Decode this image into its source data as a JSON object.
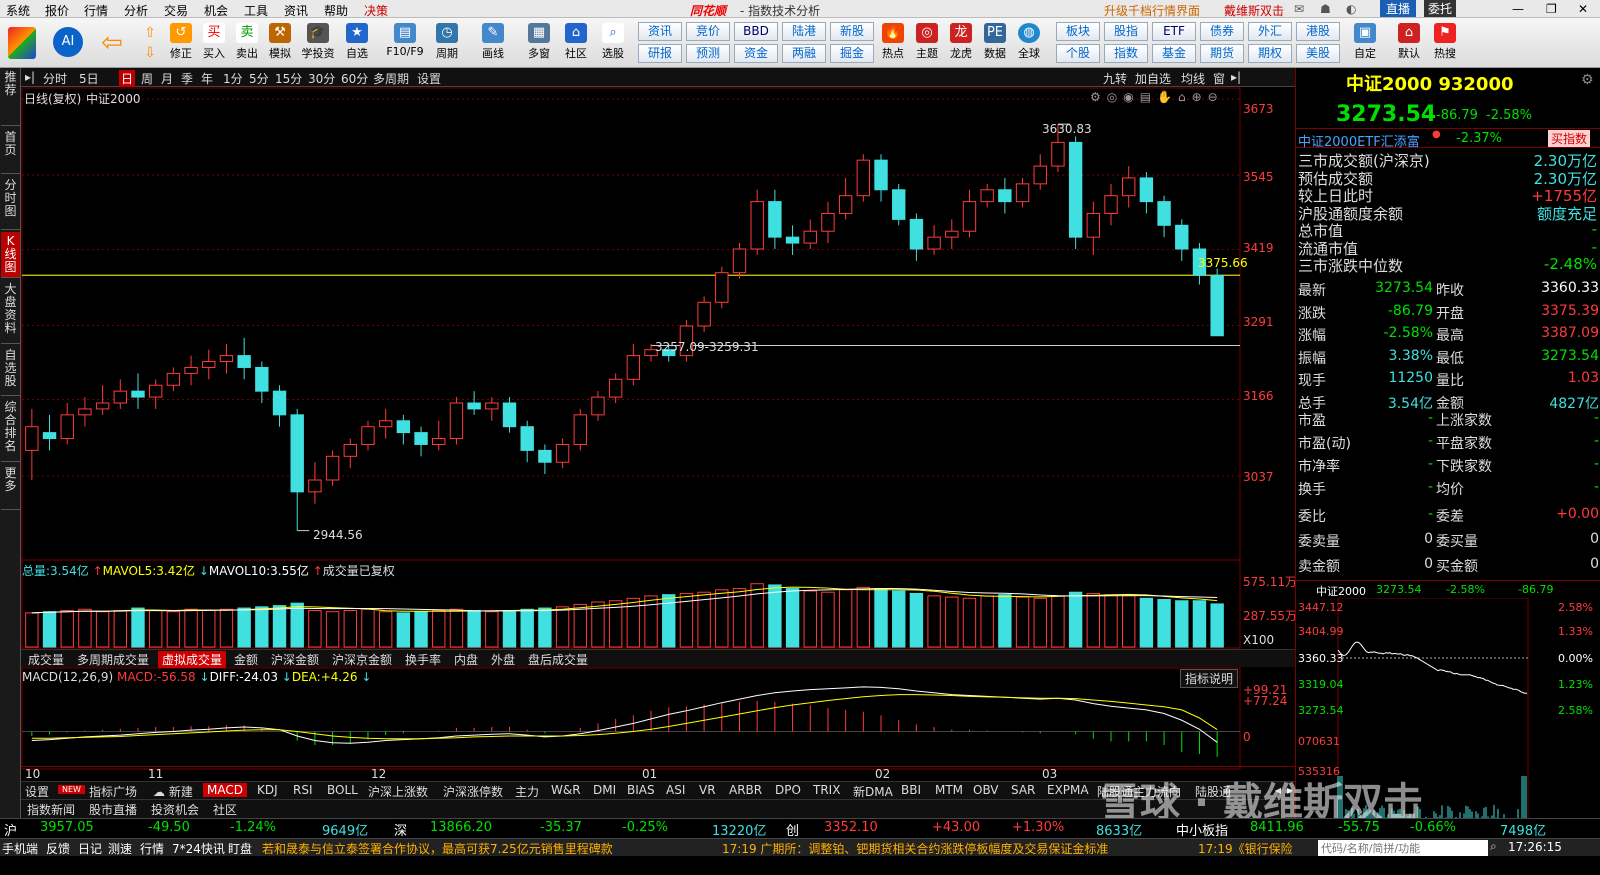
{
  "menu": [
    "系统",
    "报价",
    "行情",
    "分析",
    "交易",
    "机会",
    "工具",
    "资讯",
    "帮助",
    "决策"
  ],
  "app_logo": "同花顺",
  "window_title": "- 指数技术分析",
  "upgrade_link": "升级千档行情界面",
  "brand_link": "戴维斯双击",
  "live_btn": "直播",
  "user_btn": "委托",
  "toolbar": {
    "buttons": [
      "修正",
      "买入",
      "卖出",
      "模拟",
      "学投资",
      "自选",
      "F10/F9",
      "周期",
      "画线",
      "多窗",
      "社区",
      "选股",
      "热点",
      "主题",
      "龙虎",
      "数据",
      "全球",
      "自定",
      "默认",
      "热搜"
    ],
    "small_top": [
      "资讯",
      "竞价",
      "BBD",
      "陆港",
      "新股",
      "板块",
      "股指",
      "ETF",
      "债券",
      "外汇",
      "港股"
    ],
    "small_bot": [
      "研报",
      "预测",
      "资金",
      "两融",
      "掘金",
      "个股",
      "指数",
      "基金",
      "期货",
      "期权",
      "美股"
    ]
  },
  "left_nav": [
    "推荐",
    "首页",
    "分时图",
    "K线图",
    "大盘资料",
    "自选股",
    "综合排名",
    "更多"
  ],
  "periods": [
    "分时",
    "5日",
    "日",
    "周",
    "月",
    "季",
    "年",
    "1分",
    "5分",
    "15分",
    "30分",
    "60分",
    "多周期",
    "设置"
  ],
  "period_active": "日",
  "chart_right_tabs": [
    "九转",
    "加自选",
    "均线",
    "窗"
  ],
  "chart_header": {
    "mode": "日线(复权)",
    "name": "中证2000"
  },
  "price_annotations": {
    "high": "3630.83",
    "low": "2944.56",
    "gap": "3257.09-3259.31",
    "ref_line": "3375.66"
  },
  "volume_header": {
    "label": "总量:",
    "vol": "3.54亿",
    "mavol5_label": "MAVOL5:",
    "mavol5": "3.42亿",
    "mavol10_label": "MAVOL10:",
    "mavol10": "3.55亿",
    "note": "成交量已复权"
  },
  "volume_axis": [
    "575.11万",
    "287.55万",
    "X100"
  ],
  "vol_tabs": [
    "成交量",
    "多周期成交量",
    "虚拟成交量",
    "金额",
    "沪深金额",
    "沪深京金额",
    "换手率",
    "内盘",
    "外盘",
    "盘后成交量"
  ],
  "vol_tab_active": "虚拟成交量",
  "macd_header": {
    "label": "MACD(12,26,9)",
    "macd_label": "MACD:",
    "macd": "-56.58",
    "diff_label": "DIFF:",
    "diff": "-24.03",
    "dea_label": "DEA:",
    "dea": "+4.26"
  },
  "macd_button": "指标说明",
  "macd_axis": [
    "+99.21",
    "+77.24",
    "0"
  ],
  "date_axis": [
    "10",
    "11",
    "12",
    "01",
    "02",
    "03"
  ],
  "indicator_tabs": [
    "设置",
    "指标广场",
    "新建",
    "MACD",
    "KDJ",
    "RSI",
    "BOLL",
    "沪深上涨数",
    "沪深涨停数",
    "主力",
    "W&R",
    "DMI",
    "BIAS",
    "ASI",
    "VR",
    "ARBR",
    "DPO",
    "TRIX",
    "新DMA",
    "BBI",
    "MTM",
    "OBV",
    "SAR",
    "EXPMA",
    "陆股通主力流向",
    "陆股通"
  ],
  "indicator_active": "MACD",
  "new_badge": "NEW",
  "bottom_tabs": [
    "指数新闻",
    "股市直播",
    "投资机会",
    "社区"
  ],
  "chart_data": [
    {
      "type": "candlestick",
      "title": "中证2000",
      "ylim": [
        2900,
        3680
      ],
      "y_ticks": [
        3673,
        3545,
        3419,
        3291,
        3166,
        3037
      ],
      "x_ticks": [
        "10",
        "11",
        "12",
        "01",
        "02",
        "03"
      ],
      "candles": [
        [
          3080,
          3120,
          3150,
          3030
        ],
        [
          3110,
          3100,
          3140,
          3080
        ],
        [
          3100,
          3140,
          3160,
          3090
        ],
        [
          3140,
          3150,
          3170,
          3120
        ],
        [
          3150,
          3160,
          3190,
          3140
        ],
        [
          3160,
          3180,
          3200,
          3150
        ],
        [
          3180,
          3170,
          3210,
          3150
        ],
        [
          3170,
          3190,
          3200,
          3150
        ],
        [
          3190,
          3210,
          3220,
          3180
        ],
        [
          3210,
          3220,
          3240,
          3190
        ],
        [
          3220,
          3230,
          3250,
          3200
        ],
        [
          3230,
          3240,
          3260,
          3210
        ],
        [
          3240,
          3220,
          3270,
          3200
        ],
        [
          3220,
          3180,
          3230,
          3160
        ],
        [
          3180,
          3140,
          3190,
          3120
        ],
        [
          3140,
          3010,
          3150,
          2944.56
        ],
        [
          3010,
          3030,
          3060,
          2990
        ],
        [
          3030,
          3070,
          3080,
          3020
        ],
        [
          3070,
          3090,
          3100,
          3050
        ],
        [
          3090,
          3120,
          3130,
          3080
        ],
        [
          3120,
          3130,
          3150,
          3100
        ],
        [
          3130,
          3110,
          3140,
          3090
        ],
        [
          3110,
          3090,
          3120,
          3070
        ],
        [
          3090,
          3100,
          3130,
          3080
        ],
        [
          3100,
          3160,
          3170,
          3090
        ],
        [
          3160,
          3150,
          3180,
          3140
        ],
        [
          3150,
          3160,
          3170,
          3130
        ],
        [
          3160,
          3120,
          3170,
          3110
        ],
        [
          3120,
          3080,
          3130,
          3060
        ],
        [
          3080,
          3060,
          3090,
          3040
        ],
        [
          3060,
          3090,
          3100,
          3050
        ],
        [
          3090,
          3140,
          3150,
          3080
        ],
        [
          3140,
          3170,
          3180,
          3130
        ],
        [
          3170,
          3200,
          3210,
          3160
        ],
        [
          3200,
          3240,
          3260,
          3190
        ],
        [
          3240,
          3250,
          3260,
          3230
        ],
        [
          3250,
          3240,
          3260,
          3230
        ],
        [
          3240,
          3290,
          3300,
          3230
        ],
        [
          3290,
          3330,
          3340,
          3280
        ],
        [
          3330,
          3380,
          3390,
          3320
        ],
        [
          3380,
          3420,
          3430,
          3370
        ],
        [
          3420,
          3500,
          3520,
          3410
        ],
        [
          3500,
          3440,
          3520,
          3420
        ],
        [
          3440,
          3430,
          3460,
          3410
        ],
        [
          3430,
          3450,
          3470,
          3420
        ],
        [
          3450,
          3480,
          3500,
          3430
        ],
        [
          3480,
          3510,
          3540,
          3470
        ],
        [
          3510,
          3570,
          3580,
          3500
        ],
        [
          3570,
          3520,
          3580,
          3500
        ],
        [
          3520,
          3470,
          3530,
          3460
        ],
        [
          3470,
          3420,
          3480,
          3400
        ],
        [
          3420,
          3440,
          3460,
          3410
        ],
        [
          3440,
          3450,
          3470,
          3420
        ],
        [
          3450,
          3500,
          3520,
          3440
        ],
        [
          3500,
          3520,
          3530,
          3490
        ],
        [
          3520,
          3500,
          3540,
          3480
        ],
        [
          3500,
          3530,
          3540,
          3490
        ],
        [
          3530,
          3560,
          3580,
          3520
        ],
        [
          3560,
          3600,
          3630.83,
          3550
        ],
        [
          3600,
          3440,
          3610,
          3420
        ],
        [
          3440,
          3480,
          3500,
          3410
        ],
        [
          3480,
          3510,
          3530,
          3460
        ],
        [
          3510,
          3540,
          3560,
          3490
        ],
        [
          3540,
          3500,
          3550,
          3480
        ],
        [
          3500,
          3460,
          3510,
          3440
        ],
        [
          3460,
          3420,
          3470,
          3400
        ],
        [
          3420,
          3375.66,
          3430,
          3360
        ],
        [
          3375.39,
          3273.54,
          3387.09,
          3273.54
        ]
      ]
    },
    {
      "type": "bar",
      "title": "成交量",
      "ylim": [
        0,
        575.11
      ],
      "values": [
        280,
        290,
        300,
        310,
        290,
        300,
        320,
        300,
        290,
        310,
        300,
        310,
        320,
        330,
        340,
        360,
        300,
        290,
        300,
        310,
        290,
        280,
        290,
        300,
        310,
        300,
        290,
        300,
        310,
        320,
        330,
        350,
        370,
        380,
        400,
        420,
        430,
        440,
        450,
        470,
        480,
        520,
        510,
        480,
        460,
        450,
        470,
        490,
        480,
        460,
        440,
        420,
        410,
        400,
        420,
        430,
        410,
        400,
        420,
        450,
        440,
        430,
        420,
        400,
        390,
        380,
        380,
        354
      ]
    },
    {
      "type": "line",
      "title": "MACD",
      "series": [
        {
          "name": "DIFF",
          "values": [
            -20,
            -18,
            -15,
            -12,
            -10,
            -8,
            -5,
            -2,
            0,
            3,
            5,
            8,
            10,
            8,
            4,
            -10,
            -20,
            -25,
            -26,
            -24,
            -20,
            -18,
            -16,
            -14,
            -10,
            -8,
            -6,
            -5,
            -8,
            -12,
            -10,
            -5,
            2,
            10,
            18,
            28,
            38,
            46,
            55,
            64,
            72,
            80,
            86,
            90,
            93,
            95,
            97,
            99.21,
            98,
            95,
            90,
            86,
            82,
            80,
            78,
            76,
            74,
            72,
            74,
            70,
            62,
            56,
            52,
            48,
            40,
            25,
            5,
            -24.03
          ]
        },
        {
          "name": "DEA",
          "values": [
            -15,
            -15,
            -14,
            -13,
            -12,
            -11,
            -9,
            -7,
            -5,
            -3,
            -1,
            1,
            3,
            4,
            4,
            0,
            -5,
            -10,
            -13,
            -15,
            -16,
            -16,
            -16,
            -15,
            -14,
            -12,
            -11,
            -10,
            -10,
            -10,
            -10,
            -9,
            -7,
            -4,
            0,
            5,
            11,
            18,
            25,
            32,
            39,
            46,
            53,
            59,
            64,
            69,
            73,
            77.24,
            80,
            82,
            82,
            81,
            80,
            78,
            77,
            76,
            75,
            74,
            74,
            73,
            70,
            67,
            63,
            59,
            55,
            48,
            30,
            4.26
          ]
        }
      ]
    }
  ],
  "right_panel": {
    "title": "中证2000 932000",
    "price": "3273.54",
    "change": "-86.79",
    "pct": "-2.58%",
    "etf_name": "中证2000ETF汇添富",
    "etf_pct": "-2.37%",
    "etf_btn": "买指数",
    "rows1": [
      [
        "三市成交额(沪深京)",
        "2.30万亿"
      ],
      [
        "预估成交额",
        "2.30万亿"
      ],
      [
        "较上日此时",
        "+1755亿"
      ],
      [
        "沪股通额度余额",
        "额度充足"
      ],
      [
        "总市值",
        "-"
      ],
      [
        "流通市值",
        "-"
      ],
      [
        "三市涨跌中位数",
        "-2.48%"
      ]
    ],
    "rows2": [
      [
        "最新",
        "3273.54",
        "昨收",
        "3360.33"
      ],
      [
        "涨跌",
        "-86.79",
        "开盘",
        "3375.39"
      ],
      [
        "涨幅",
        "-2.58%",
        "最高",
        "3387.09"
      ],
      [
        "振幅",
        "3.38%",
        "最低",
        "3273.54"
      ],
      [
        "现手",
        "11250",
        "量比",
        "1.03"
      ],
      [
        "总手",
        "3.54亿",
        "金额",
        "4827亿"
      ]
    ],
    "rows3": [
      [
        "市盈",
        "-",
        "上涨家数",
        "-"
      ],
      [
        "市盈(动)",
        "-",
        "平盘家数",
        "-"
      ],
      [
        "市净率",
        "-",
        "下跌家数",
        "-"
      ],
      [
        "换手",
        "-",
        "均价",
        "-"
      ]
    ],
    "rows4": [
      [
        "委比",
        "-",
        "委差",
        "+0.00"
      ],
      [
        "委卖量",
        "0",
        "委买量",
        "0"
      ],
      [
        "卖金额",
        "0",
        "买金额",
        "0"
      ]
    ],
    "mini_header": [
      "中证2000",
      "3273.54",
      "-2.58%",
      "-86.79"
    ],
    "mini_left_axis": [
      "3447.12",
      "3404.99",
      "3360.33",
      "3319.04",
      "3273.54",
      "070631",
      "535316"
    ],
    "mini_right_axis": [
      "2.58%",
      "1.33%",
      "0.00%",
      "1.23%",
      "2.58%"
    ]
  },
  "status": {
    "sh_label": "沪",
    "sh_val": "3957.05",
    "sh_chg": "-49.50",
    "sh_pct": "-1.24%",
    "sh_amt": "9649亿",
    "sz_label": "深",
    "sz_val": "13866.20",
    "sz_chg": "-35.37",
    "sz_pct": "-0.25%",
    "sz_amt": "13220亿",
    "cy_label": "创",
    "cy_val": "3352.10",
    "cy_chg": "+43.00",
    "cy_pct": "+1.30%",
    "cy_amt": "8633亿",
    "zx_label": "中小板指",
    "zx_val": "8411.96",
    "zx_chg": "-55.75",
    "zx_pct": "-0.66%",
    "zx_amt": "7498亿"
  },
  "newsbar": {
    "items": [
      "手机端",
      "反馈",
      "日记",
      "测速",
      "行情",
      "7*24快讯",
      "盯盘"
    ],
    "news1": "若和晟泰与信立泰签署合作协议，最高可获7.25亿元销售里程碑款",
    "news2": "17:19 广期所：调整铂、钯期货相关合约涨跌停板幅度及交易保证金标准",
    "news3": "17:19《银行保险",
    "search_placeholder": "代码/名称/简拼/功能",
    "clock": "17:26:15"
  },
  "watermark": "雪球 · 戴维斯双击"
}
